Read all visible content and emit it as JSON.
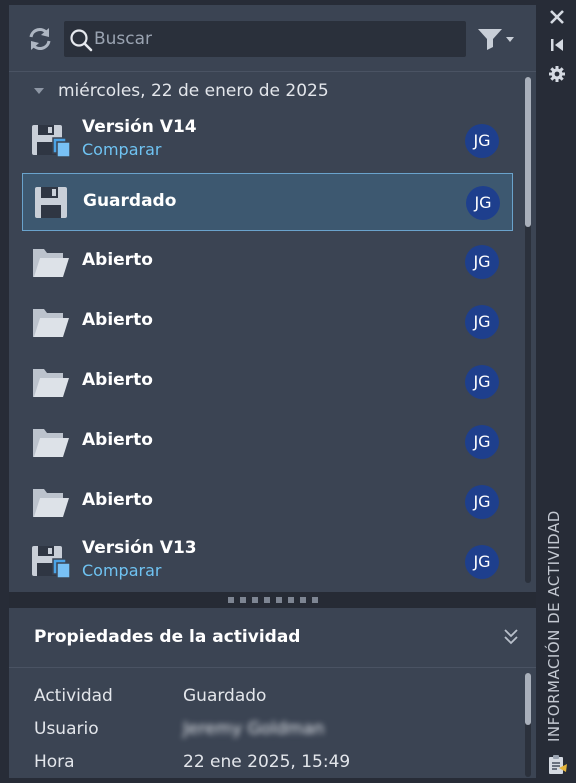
{
  "toolbar": {
    "search_placeholder": "Buscar"
  },
  "group": {
    "date": "miércoles, 22 de enero de 2025"
  },
  "items": [
    {
      "icon": "save-version-icon",
      "title": "Versión V14",
      "link": "Comparar",
      "user": "JG",
      "selected": false
    },
    {
      "icon": "save-icon",
      "title": "Guardado",
      "user": "JG",
      "selected": true
    },
    {
      "icon": "open-folder-icon",
      "title": "Abierto",
      "user": "JG",
      "selected": false
    },
    {
      "icon": "open-folder-icon",
      "title": "Abierto",
      "user": "JG",
      "selected": false
    },
    {
      "icon": "open-folder-icon",
      "title": "Abierto",
      "user": "JG",
      "selected": false
    },
    {
      "icon": "open-folder-icon",
      "title": "Abierto",
      "user": "JG",
      "selected": false
    },
    {
      "icon": "open-folder-icon",
      "title": "Abierto",
      "user": "JG",
      "selected": false
    },
    {
      "icon": "save-version-icon",
      "title": "Versión V13",
      "link": "Comparar",
      "user": "JG",
      "selected": false
    }
  ],
  "properties": {
    "title": "Propiedades de la actividad",
    "rows": [
      {
        "label": "Actividad",
        "value": "Guardado"
      },
      {
        "label": "Usuario",
        "value": "Jeremy Goldman",
        "redacted": true
      },
      {
        "label": "Hora",
        "value": "22 ene 2025, 15:49"
      }
    ]
  },
  "sidebar": {
    "title": "INFORMACIÓN DE ACTIVIDAD"
  },
  "colors": {
    "panel": "#3b4453",
    "selected": "#3d5870",
    "avatar": "#1e3f8d",
    "link": "#6fc3f2"
  }
}
